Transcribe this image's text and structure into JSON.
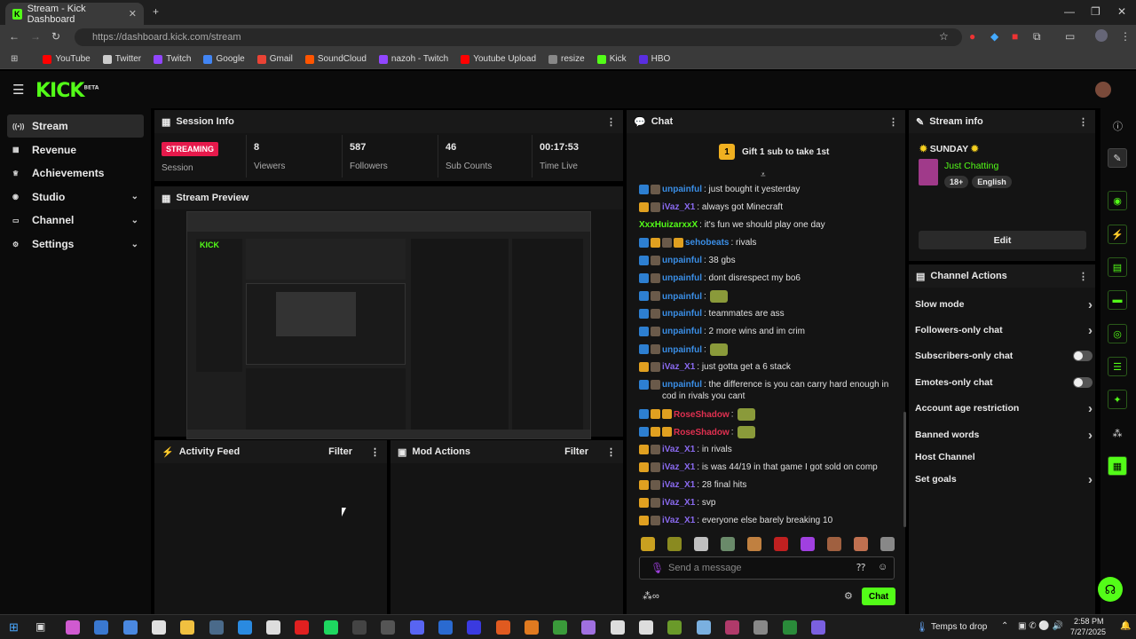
{
  "browser": {
    "tab_title": "Stream - Kick Dashboard",
    "url": "https://dashboard.kick.com/stream",
    "bookmarks": [
      {
        "label": "YouTube",
        "color": "#ff0000"
      },
      {
        "label": "Twitter",
        "color": "#cccccc"
      },
      {
        "label": "Twitch",
        "color": "#9146ff"
      },
      {
        "label": "Google",
        "color": "#4285f4"
      },
      {
        "label": "Gmail",
        "color": "#ea4335"
      },
      {
        "label": "SoundCloud",
        "color": "#ff5500"
      },
      {
        "label": "nazoh - Twitch",
        "color": "#9146ff"
      },
      {
        "label": "Youtube Upload",
        "color": "#ff0000"
      },
      {
        "label": "resize",
        "color": "#888888"
      },
      {
        "label": "Kick",
        "color": "#53fc18"
      },
      {
        "label": "HBO",
        "color": "#5a2ee0"
      }
    ]
  },
  "app": {
    "logo": "KICK",
    "logo_sup": "BETA"
  },
  "sidebar": {
    "items": [
      {
        "label": "Stream",
        "icon": "broadcast-icon",
        "active": true
      },
      {
        "label": "Revenue",
        "icon": "bank-icon"
      },
      {
        "label": "Achievements",
        "icon": "trophy-icon"
      },
      {
        "label": "Studio",
        "icon": "studio-icon",
        "expandable": true
      },
      {
        "label": "Channel",
        "icon": "channel-icon",
        "expandable": true
      },
      {
        "label": "Settings",
        "icon": "gear-icon",
        "expandable": true
      }
    ]
  },
  "session": {
    "title": "Session Info",
    "badge": "STREAMING",
    "session_label": "Session",
    "stats": [
      {
        "value": "8",
        "label": "Viewers"
      },
      {
        "value": "587",
        "label": "Followers"
      },
      {
        "value": "46",
        "label": "Sub Counts"
      },
      {
        "value": "00:17:53",
        "label": "Time Live"
      }
    ]
  },
  "preview": {
    "title": "Stream Preview"
  },
  "activity": {
    "title": "Activity Feed",
    "filter": "Filter"
  },
  "mod": {
    "title": "Mod Actions",
    "filter": "Filter"
  },
  "chat": {
    "title": "Chat",
    "pinned_num": "1",
    "pinned_text": "Gift 1 sub to take 1st",
    "placeholder": "Send a message",
    "send_label": "Chat",
    "messages": [
      {
        "user": "unpainful",
        "color": "#3a8ee6",
        "badges": [
          "vip",
          "sub"
        ],
        "text": ": just bought it yesterday"
      },
      {
        "user": "iVaz_X1",
        "color": "#8a6af0",
        "badges": [
          "mod",
          "sub"
        ],
        "text": ": always got Minecraft"
      },
      {
        "user": "XxxHuizarxxX",
        "color": "#53fc18",
        "badges": [],
        "text": ": it's fun we should play one day"
      },
      {
        "user": "sehobeats",
        "color": "#3a8ee6",
        "badges": [
          "vip",
          "mod",
          "sub",
          "mod"
        ],
        "text": ": rivals"
      },
      {
        "user": "unpainful",
        "color": "#3a8ee6",
        "badges": [
          "vip",
          "sub"
        ],
        "text": ": 38 gbs"
      },
      {
        "user": "unpainful",
        "color": "#3a8ee6",
        "badges": [
          "vip",
          "sub"
        ],
        "text": ": dont disrespect my bo6"
      },
      {
        "user": "unpainful",
        "color": "#3a8ee6",
        "badges": [
          "vip",
          "sub"
        ],
        "text": ":"
      },
      {
        "user": "unpainful",
        "color": "#3a8ee6",
        "badges": [
          "vip",
          "sub"
        ],
        "text": ": teammates are ass"
      },
      {
        "user": "unpainful",
        "color": "#3a8ee6",
        "badges": [
          "vip",
          "sub"
        ],
        "text": ": 2 more wins and im crim"
      },
      {
        "user": "unpainful",
        "color": "#3a8ee6",
        "badges": [
          "vip",
          "sub"
        ],
        "text": ":"
      },
      {
        "user": "iVaz_X1",
        "color": "#8a6af0",
        "badges": [
          "mod",
          "sub"
        ],
        "text": ": just gotta get a 6 stack"
      },
      {
        "user": "unpainful",
        "color": "#3a8ee6",
        "badges": [
          "vip",
          "sub"
        ],
        "text": ": the difference is you can carry hard enough in cod in rivals you cant"
      },
      {
        "user": "RoseShadow",
        "color": "#e03050",
        "badges": [
          "vip",
          "mod",
          "mod"
        ],
        "text": ":"
      },
      {
        "user": "RoseShadow",
        "color": "#e03050",
        "badges": [
          "vip",
          "mod",
          "mod"
        ],
        "text": ":"
      },
      {
        "user": "iVaz_X1",
        "color": "#8a6af0",
        "badges": [
          "mod",
          "sub"
        ],
        "text": ": in rivals"
      },
      {
        "user": "iVaz_X1",
        "color": "#8a6af0",
        "badges": [
          "mod",
          "sub"
        ],
        "text": ": is was 44/19 in that game I got sold on comp"
      },
      {
        "user": "iVaz_X1",
        "color": "#8a6af0",
        "badges": [
          "mod",
          "sub"
        ],
        "text": ": 28 final hits"
      },
      {
        "user": "iVaz_X1",
        "color": "#8a6af0",
        "badges": [
          "mod",
          "sub"
        ],
        "text": ": svp"
      },
      {
        "user": "iVaz_X1",
        "color": "#8a6af0",
        "badges": [
          "mod",
          "sub"
        ],
        "text": ": everyone else barely breaking 10"
      }
    ]
  },
  "stream_info": {
    "title": "Stream info",
    "stream_title": "SUNDAY",
    "category": "Just Chatting",
    "tags": [
      "18+",
      "English"
    ],
    "edit_label": "Edit"
  },
  "channel_actions": {
    "title": "Channel Actions",
    "items": [
      {
        "label": "Slow mode",
        "kind": "chevron"
      },
      {
        "label": "Followers-only chat",
        "kind": "chevron"
      },
      {
        "label": "Subscribers-only chat",
        "kind": "toggle"
      },
      {
        "label": "Emotes-only chat",
        "kind": "toggle"
      },
      {
        "label": "Account age restriction",
        "kind": "chevron"
      },
      {
        "label": "Banned words",
        "kind": "chevron"
      },
      {
        "label": "Host Channel",
        "kind": "none"
      },
      {
        "label": "Set goals",
        "kind": "chevron"
      }
    ]
  },
  "taskbar": {
    "weather": "Temps to drop",
    "time": "2:58 PM",
    "date": "7/27/2025"
  },
  "colors": {
    "accent": "#53fc18",
    "live": "#e6194b"
  }
}
